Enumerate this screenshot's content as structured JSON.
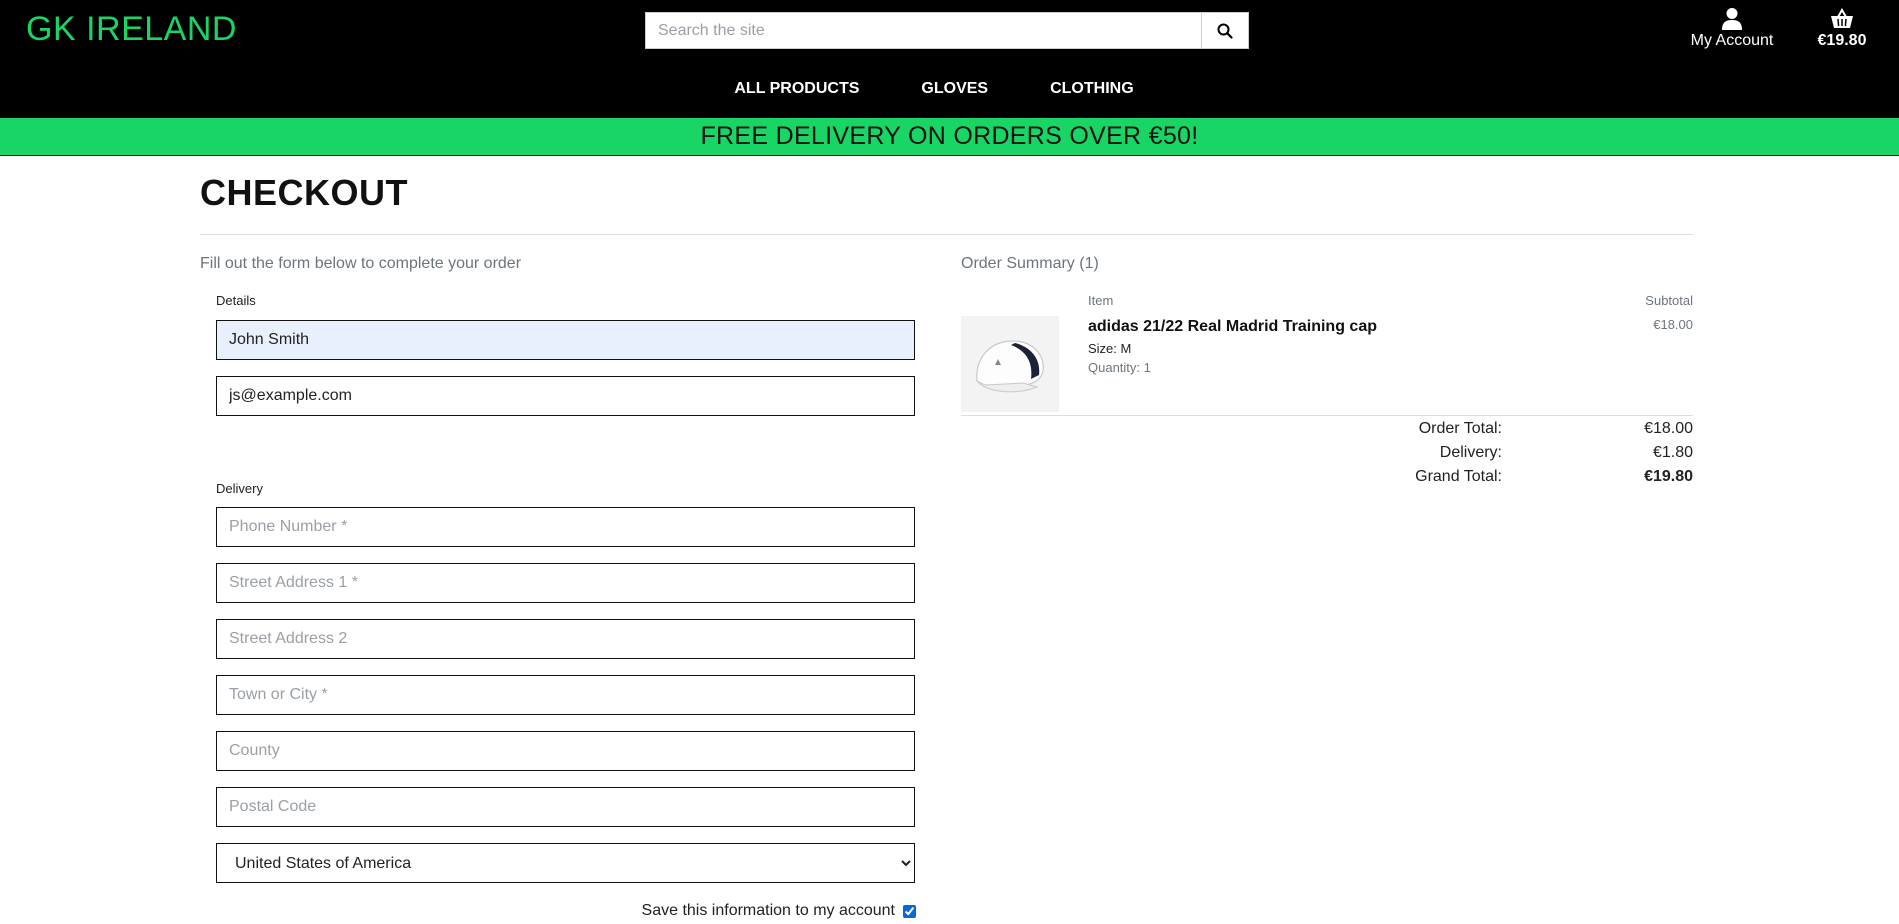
{
  "header": {
    "brand": "GK IRELAND",
    "search_placeholder": "Search the site",
    "account_label": "My Account",
    "bag_total": "€19.80",
    "nav": [
      "ALL PRODUCTS",
      "GLOVES",
      "CLOTHING"
    ],
    "icons": {
      "search": "search-icon",
      "account": "user-icon",
      "bag": "basket-icon"
    }
  },
  "banner": {
    "text": "FREE DELIVERY ON ORDERS OVER €50!",
    "color": "#19d565"
  },
  "checkout": {
    "title": "CHECKOUT",
    "intro": "Fill out the form below to complete your order",
    "details_label": "Details",
    "full_name": "John Smith",
    "email": "js@example.com",
    "delivery_label": "Delivery",
    "placeholders": {
      "phone": "Phone Number *",
      "street1": "Street Address 1 *",
      "street2": "Street Address 2",
      "town": "Town or City *",
      "county": "County",
      "postcode": "Postal Code"
    },
    "country": "United States of America",
    "save_info_label": "Save this information to my account",
    "save_info_checked": true
  },
  "summary": {
    "title": "Order Summary (1)",
    "col_item": "Item",
    "col_subtotal": "Subtotal",
    "item": {
      "name": "adidas 21/22 Real Madrid Training cap",
      "size": "Size: M",
      "quantity": "Quantity: 1",
      "subtotal": "€18.00"
    },
    "totals": {
      "order_total_label": "Order Total:",
      "order_total": "€18.00",
      "delivery_label": "Delivery:",
      "delivery": "€1.80",
      "grand_total_label": "Grand Total:",
      "grand_total": "€19.80"
    }
  }
}
